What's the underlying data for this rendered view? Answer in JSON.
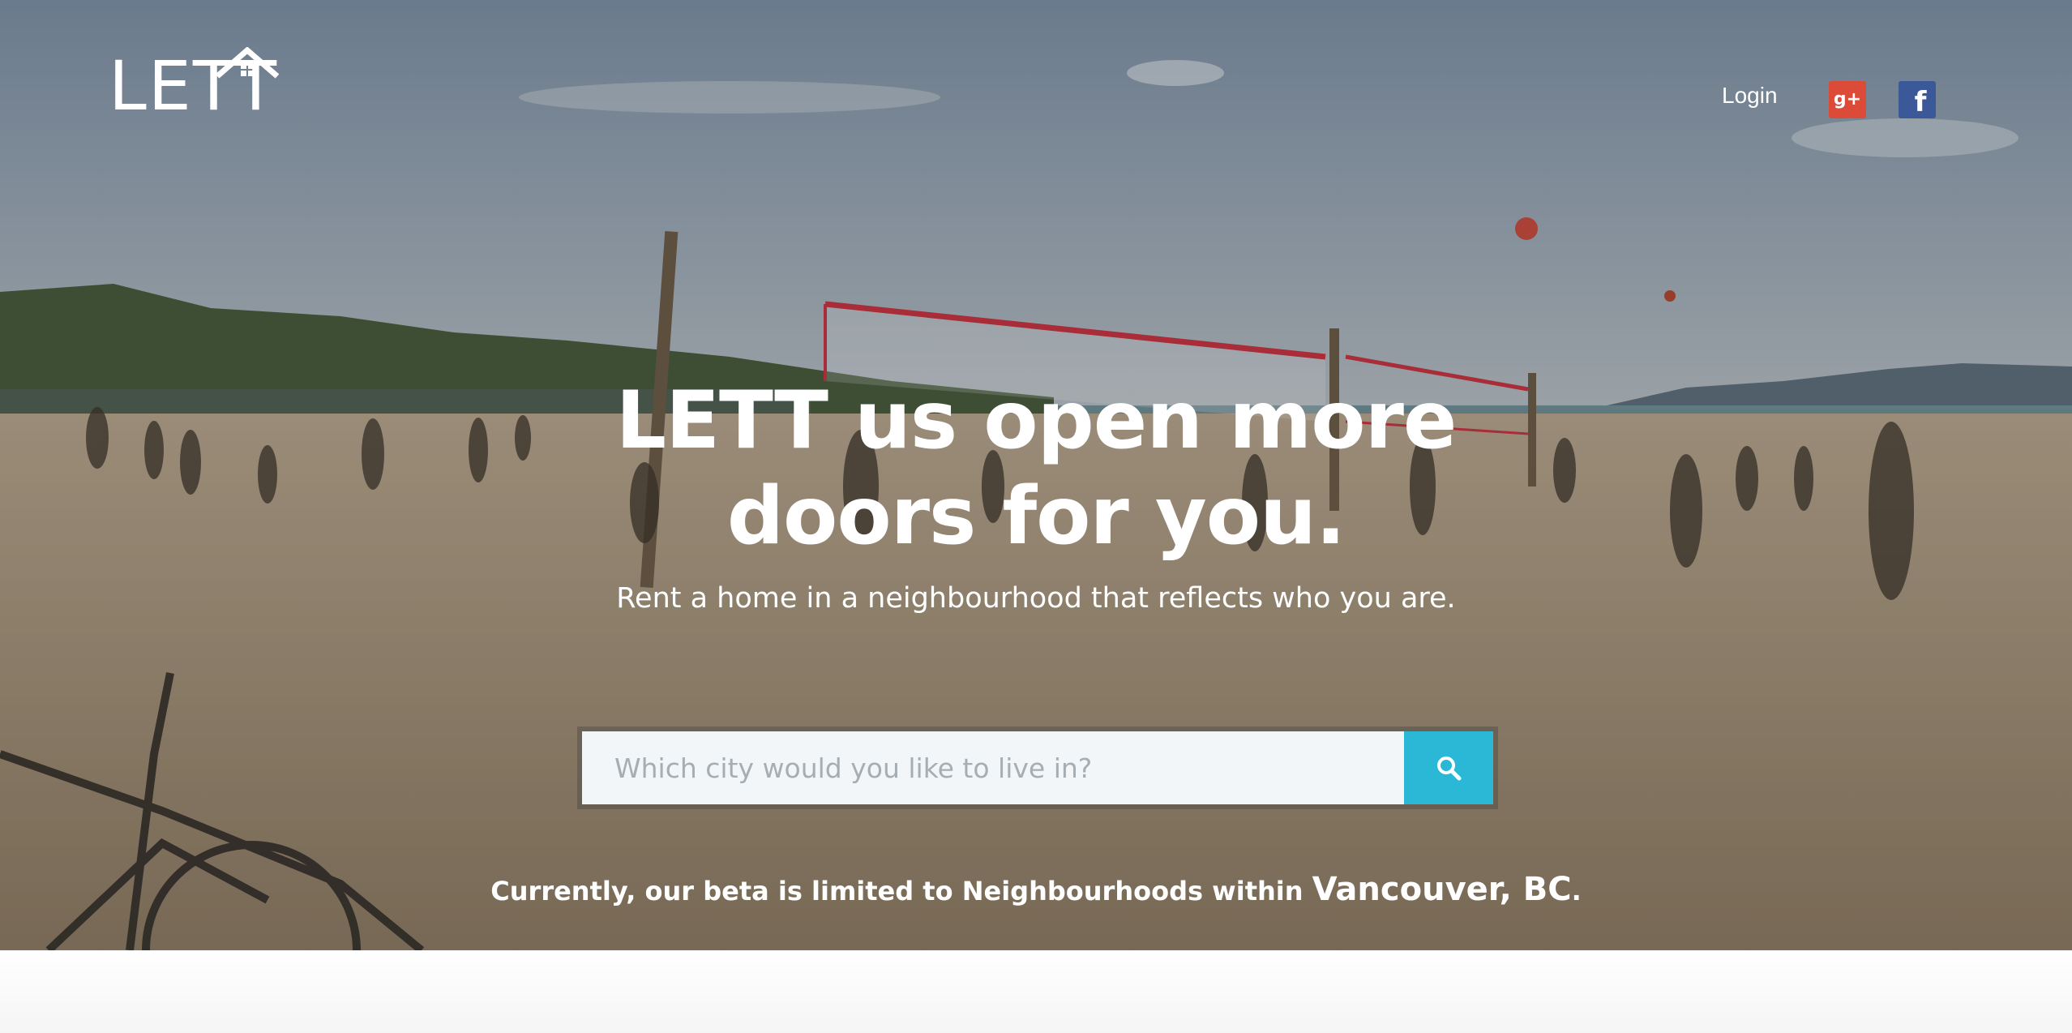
{
  "brand": {
    "logo_text": "LETT"
  },
  "nav": {
    "login_label": "Login",
    "google_icon": "google-plus-icon",
    "google_glyph": "g+",
    "facebook_icon": "facebook-icon",
    "facebook_glyph": "f"
  },
  "hero": {
    "headline_line1": "LETT us open more",
    "headline_line2": "doors for you.",
    "subheadline": "Rent a home in a neighbourhood that reflects who you are.",
    "search": {
      "placeholder": "Which city would you like to live in?",
      "value": "",
      "button_icon": "search-icon"
    },
    "beta_note": {
      "prefix": "Currently, our beta is limited to Neighbourhoods within ",
      "city": "Vancouver, BC",
      "suffix": "."
    }
  },
  "colors": {
    "accent": "#2bb8d6",
    "google": "#dc4a38",
    "facebook": "#3b5998"
  }
}
